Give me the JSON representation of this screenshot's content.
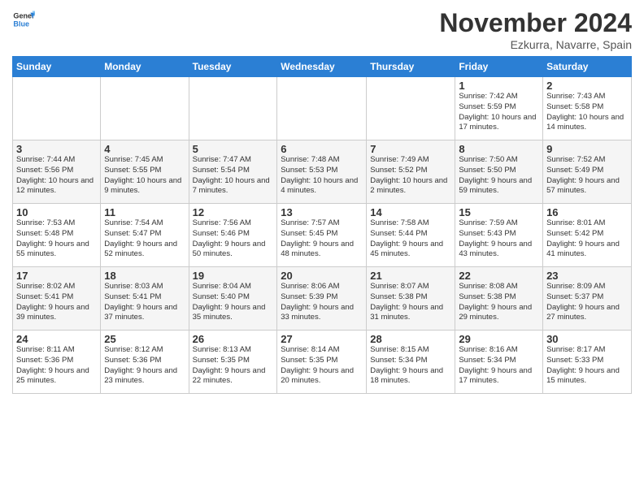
{
  "header": {
    "logo_general": "General",
    "logo_blue": "Blue",
    "month_title": "November 2024",
    "location": "Ezkurra, Navarre, Spain"
  },
  "days_of_week": [
    "Sunday",
    "Monday",
    "Tuesday",
    "Wednesday",
    "Thursday",
    "Friday",
    "Saturday"
  ],
  "weeks": [
    [
      {
        "day": "",
        "info": ""
      },
      {
        "day": "",
        "info": ""
      },
      {
        "day": "",
        "info": ""
      },
      {
        "day": "",
        "info": ""
      },
      {
        "day": "",
        "info": ""
      },
      {
        "day": "1",
        "info": "Sunrise: 7:42 AM\nSunset: 5:59 PM\nDaylight: 10 hours and 17 minutes."
      },
      {
        "day": "2",
        "info": "Sunrise: 7:43 AM\nSunset: 5:58 PM\nDaylight: 10 hours and 14 minutes."
      }
    ],
    [
      {
        "day": "3",
        "info": "Sunrise: 7:44 AM\nSunset: 5:56 PM\nDaylight: 10 hours and 12 minutes."
      },
      {
        "day": "4",
        "info": "Sunrise: 7:45 AM\nSunset: 5:55 PM\nDaylight: 10 hours and 9 minutes."
      },
      {
        "day": "5",
        "info": "Sunrise: 7:47 AM\nSunset: 5:54 PM\nDaylight: 10 hours and 7 minutes."
      },
      {
        "day": "6",
        "info": "Sunrise: 7:48 AM\nSunset: 5:53 PM\nDaylight: 10 hours and 4 minutes."
      },
      {
        "day": "7",
        "info": "Sunrise: 7:49 AM\nSunset: 5:52 PM\nDaylight: 10 hours and 2 minutes."
      },
      {
        "day": "8",
        "info": "Sunrise: 7:50 AM\nSunset: 5:50 PM\nDaylight: 9 hours and 59 minutes."
      },
      {
        "day": "9",
        "info": "Sunrise: 7:52 AM\nSunset: 5:49 PM\nDaylight: 9 hours and 57 minutes."
      }
    ],
    [
      {
        "day": "10",
        "info": "Sunrise: 7:53 AM\nSunset: 5:48 PM\nDaylight: 9 hours and 55 minutes."
      },
      {
        "day": "11",
        "info": "Sunrise: 7:54 AM\nSunset: 5:47 PM\nDaylight: 9 hours and 52 minutes."
      },
      {
        "day": "12",
        "info": "Sunrise: 7:56 AM\nSunset: 5:46 PM\nDaylight: 9 hours and 50 minutes."
      },
      {
        "day": "13",
        "info": "Sunrise: 7:57 AM\nSunset: 5:45 PM\nDaylight: 9 hours and 48 minutes."
      },
      {
        "day": "14",
        "info": "Sunrise: 7:58 AM\nSunset: 5:44 PM\nDaylight: 9 hours and 45 minutes."
      },
      {
        "day": "15",
        "info": "Sunrise: 7:59 AM\nSunset: 5:43 PM\nDaylight: 9 hours and 43 minutes."
      },
      {
        "day": "16",
        "info": "Sunrise: 8:01 AM\nSunset: 5:42 PM\nDaylight: 9 hours and 41 minutes."
      }
    ],
    [
      {
        "day": "17",
        "info": "Sunrise: 8:02 AM\nSunset: 5:41 PM\nDaylight: 9 hours and 39 minutes."
      },
      {
        "day": "18",
        "info": "Sunrise: 8:03 AM\nSunset: 5:41 PM\nDaylight: 9 hours and 37 minutes."
      },
      {
        "day": "19",
        "info": "Sunrise: 8:04 AM\nSunset: 5:40 PM\nDaylight: 9 hours and 35 minutes."
      },
      {
        "day": "20",
        "info": "Sunrise: 8:06 AM\nSunset: 5:39 PM\nDaylight: 9 hours and 33 minutes."
      },
      {
        "day": "21",
        "info": "Sunrise: 8:07 AM\nSunset: 5:38 PM\nDaylight: 9 hours and 31 minutes."
      },
      {
        "day": "22",
        "info": "Sunrise: 8:08 AM\nSunset: 5:38 PM\nDaylight: 9 hours and 29 minutes."
      },
      {
        "day": "23",
        "info": "Sunrise: 8:09 AM\nSunset: 5:37 PM\nDaylight: 9 hours and 27 minutes."
      }
    ],
    [
      {
        "day": "24",
        "info": "Sunrise: 8:11 AM\nSunset: 5:36 PM\nDaylight: 9 hours and 25 minutes."
      },
      {
        "day": "25",
        "info": "Sunrise: 8:12 AM\nSunset: 5:36 PM\nDaylight: 9 hours and 23 minutes."
      },
      {
        "day": "26",
        "info": "Sunrise: 8:13 AM\nSunset: 5:35 PM\nDaylight: 9 hours and 22 minutes."
      },
      {
        "day": "27",
        "info": "Sunrise: 8:14 AM\nSunset: 5:35 PM\nDaylight: 9 hours and 20 minutes."
      },
      {
        "day": "28",
        "info": "Sunrise: 8:15 AM\nSunset: 5:34 PM\nDaylight: 9 hours and 18 minutes."
      },
      {
        "day": "29",
        "info": "Sunrise: 8:16 AM\nSunset: 5:34 PM\nDaylight: 9 hours and 17 minutes."
      },
      {
        "day": "30",
        "info": "Sunrise: 8:17 AM\nSunset: 5:33 PM\nDaylight: 9 hours and 15 minutes."
      }
    ]
  ]
}
